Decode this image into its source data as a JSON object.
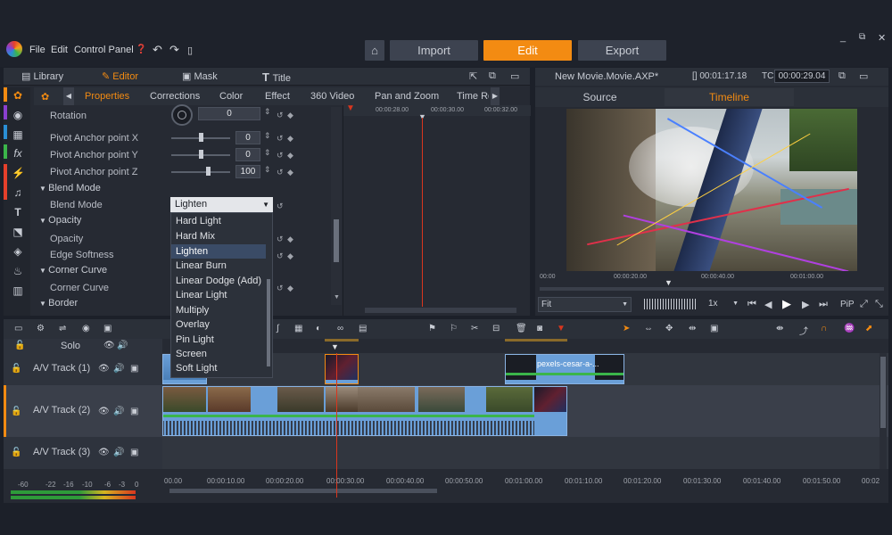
{
  "menu": {
    "file": "File",
    "edit": "Edit",
    "control_panel": "Control Panel"
  },
  "nav": {
    "import": "Import",
    "edit": "Edit",
    "export": "Export"
  },
  "editor_tabs": {
    "library": "Library",
    "editor": "Editor",
    "mask": "Mask",
    "title": "Title"
  },
  "sub_tabs": [
    "Properties",
    "Corrections",
    "Color",
    "Effect",
    "360 Video",
    "Pan and Zoom",
    "Time Re"
  ],
  "properties": {
    "rotation": {
      "label": "Rotation",
      "value": "0"
    },
    "pivot_x": {
      "label": "Pivot Anchor point X",
      "value": "0"
    },
    "pivot_y": {
      "label": "Pivot Anchor point Y",
      "value": "0"
    },
    "pivot_z": {
      "label": "Pivot Anchor point Z",
      "value": "100"
    },
    "blend_group": "Blend Mode",
    "blend_mode": {
      "label": "Blend Mode",
      "value": "Lighten"
    },
    "opacity_group": "Opacity",
    "opacity": "Opacity",
    "edge_softness": "Edge Softness",
    "corner_group": "Corner Curve",
    "corner_curve": "Corner Curve",
    "border": "Border"
  },
  "blend_options": [
    "Hard Light",
    "Hard Mix",
    "Lighten",
    "Linear Burn",
    "Linear Dodge (Add)",
    "Linear Light",
    "Multiply",
    "Overlay",
    "Pin Light",
    "Screen",
    "Soft Light"
  ],
  "keyframe_ruler": [
    "00:00:28.00",
    "00:00:30.00",
    "00:00:32.00"
  ],
  "monitor": {
    "project_title": "New Movie.Movie.AXP*",
    "timecode_left": "[] 00:01:17.18",
    "tc_label": "TC",
    "timecode": "00:00:29.04",
    "source_tab": "Source",
    "timeline_tab": "Timeline",
    "ruler": [
      "00:00",
      "00:00:20.00",
      "00:00:40.00",
      "00:01:00.00"
    ],
    "fit": "Fit",
    "speed": "1x",
    "pip": "PiP"
  },
  "tracks": {
    "solo": "Solo",
    "track1": "A/V Track (1)",
    "track2": "A/V Track (2)",
    "track3": "A/V Track (3)",
    "clip_name": "pexels-cesar-a-..."
  },
  "timeline_ruler": [
    "00.00",
    "00:00:10.00",
    "00:00:20.00",
    "00:00:30.00",
    "00:00:40.00",
    "00:00:50.00",
    "00:01:00.00",
    "00:01:10.00",
    "00:01:20.00",
    "00:01:30.00",
    "00:01:40.00",
    "00:01:50.00",
    "00:02"
  ],
  "meter_labels": [
    "-60",
    "-22",
    "-16",
    "-10",
    "-6",
    "-3",
    "0"
  ],
  "colors": {
    "accent": "#f38b12",
    "clip": "#6a9fd8",
    "playhead": "#d9361e"
  }
}
